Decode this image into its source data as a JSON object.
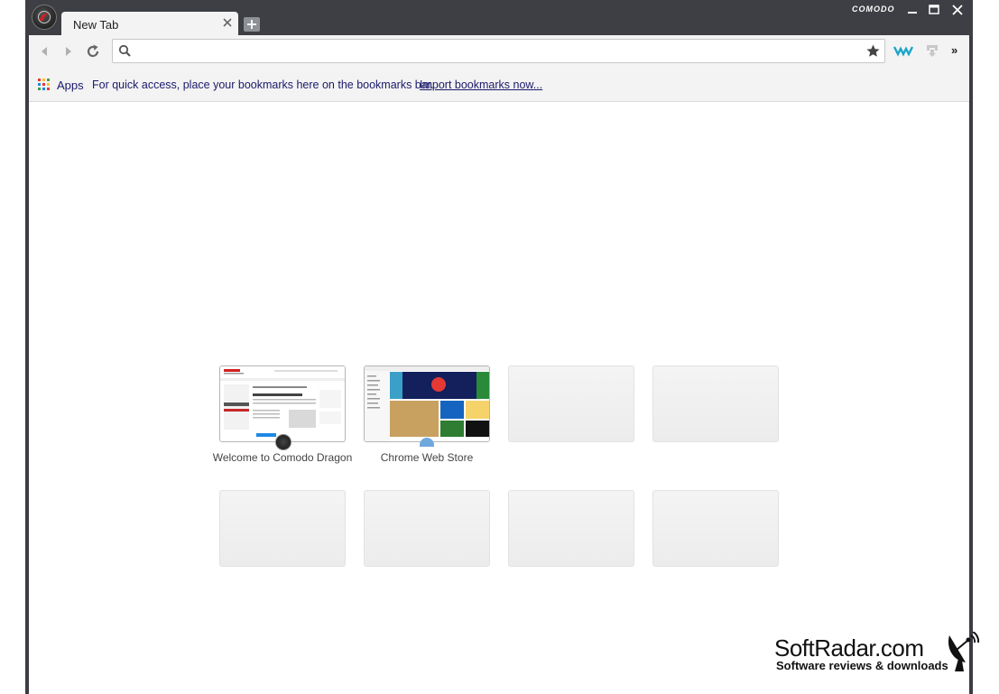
{
  "window": {
    "brand": "COMODO",
    "tab": {
      "title": "New Tab"
    }
  },
  "toolbar": {
    "omnibox_value": "",
    "omnibox_placeholder": ""
  },
  "bookmarks_bar": {
    "apps_label": "Apps",
    "message": "For quick access, place your bookmarks here on the bookmarks bar.",
    "import_link": "Import bookmarks now..."
  },
  "most_visited": [
    {
      "label": "Welcome to Comodo Dragon"
    },
    {
      "label": "Chrome Web Store"
    },
    {
      "label": ""
    },
    {
      "label": ""
    },
    {
      "label": ""
    },
    {
      "label": ""
    },
    {
      "label": ""
    },
    {
      "label": ""
    }
  ],
  "watermark": {
    "title": "SoftRadar.com",
    "subtitle": "Software reviews & downloads"
  },
  "colors": {
    "frame": "#3d3f44",
    "toolbar": "#f3f3f3",
    "link": "#1a1a6a"
  }
}
